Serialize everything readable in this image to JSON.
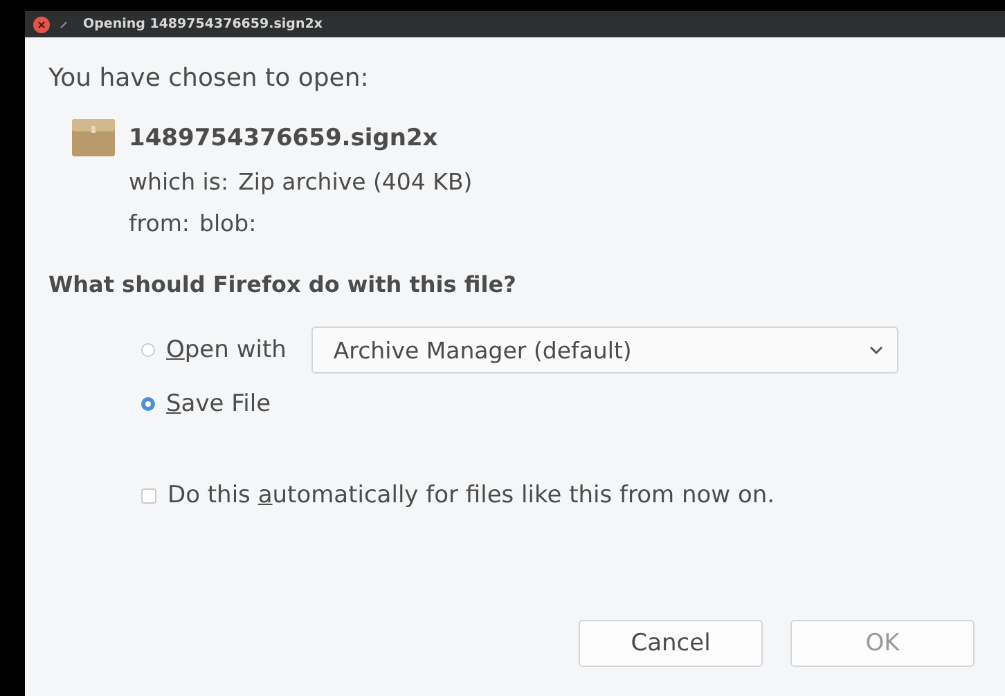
{
  "window": {
    "title": "Opening 1489754376659.sign2x"
  },
  "intro": "You have chosen to open:",
  "file": {
    "name": "1489754376659.sign2x",
    "details": [
      {
        "label": "which is:",
        "value": "Zip archive (404 KB)"
      },
      {
        "label": "from:",
        "value": "blob:"
      }
    ]
  },
  "question": "What should Firefox do with this file?",
  "options": [
    {
      "kind": "open",
      "key": "O",
      "post": "pen with",
      "selected": false,
      "app": "Archive Manager (default)"
    },
    {
      "kind": "save",
      "key": "S",
      "post": "ave File",
      "selected": true
    }
  ],
  "auto": {
    "pre": "Do this ",
    "key": "a",
    "post": "utomatically for files like this from now on.",
    "checked": false
  },
  "buttons": [
    {
      "label": "Cancel",
      "disabled": false
    },
    {
      "label": "OK",
      "disabled": true
    }
  ]
}
